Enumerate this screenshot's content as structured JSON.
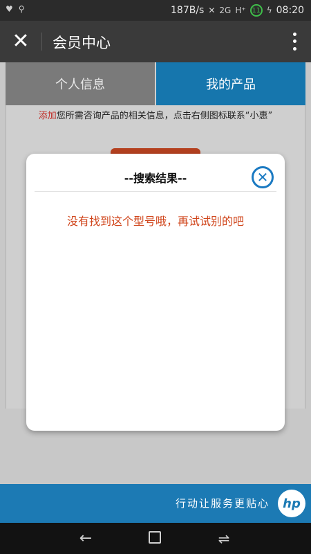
{
  "status_bar": {
    "net_speed": "187B/s",
    "signal_2g": "2G",
    "signal_h": "H⁺",
    "battery_level": "11",
    "time": "08:20"
  },
  "app_bar": {
    "title": "会员中心"
  },
  "tabs": [
    {
      "label": "个人信息",
      "active": false
    },
    {
      "label": "我的产品",
      "active": true
    }
  ],
  "info": {
    "add_link": "添加",
    "text": "您所需咨询产品的相关信息，点击右侧图标联系“小惠”"
  },
  "modal": {
    "title": "--搜索结果--",
    "message": "没有找到这个型号哦，再试试别的吧"
  },
  "footer": {
    "slogan": "行动让服务更贴心",
    "logo_text": "hp"
  },
  "colors": {
    "tab_active": "#1676ad",
    "footer": "#1c7ab4",
    "message": "#d0451b",
    "add_link": "#c0302b"
  },
  "icons": [
    "heart-rate-icon",
    "usb-icon",
    "mute-icon",
    "signal-icon",
    "battery-icon",
    "close-icon",
    "more-vertical-icon",
    "modal-close-icon",
    "nav-back-icon",
    "nav-home-icon",
    "nav-recent-icon"
  ]
}
